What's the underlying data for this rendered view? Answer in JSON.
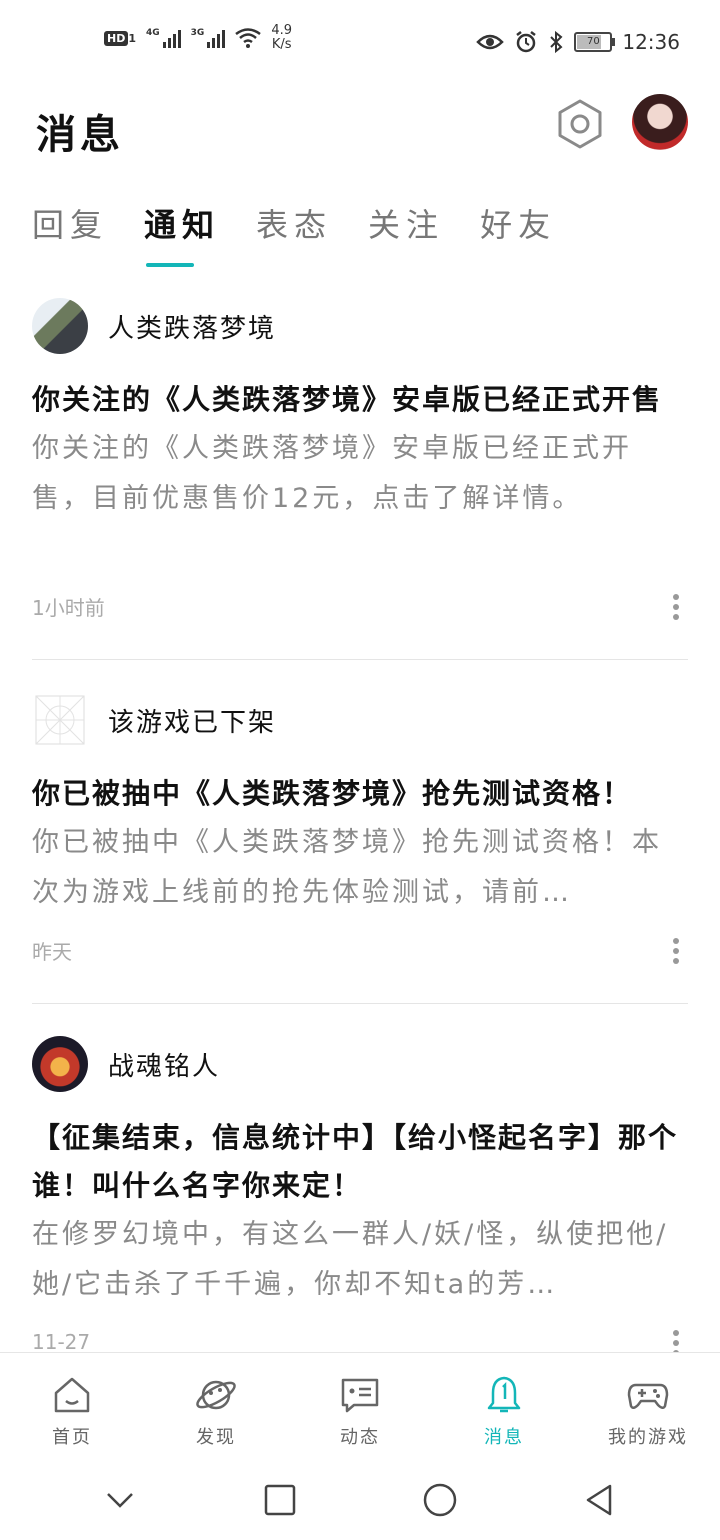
{
  "status_bar": {
    "hd": "HD",
    "sim1": "1",
    "net1": "4G",
    "net2": "3G",
    "speed_value": "4.9",
    "speed_unit": "K/s",
    "battery": "70",
    "time": "12:36"
  },
  "header": {
    "title": "消息"
  },
  "tabs": [
    {
      "label": "回复",
      "active": false
    },
    {
      "label": "通知",
      "active": true
    },
    {
      "label": "表态",
      "active": false
    },
    {
      "label": "关注",
      "active": false
    },
    {
      "label": "好友",
      "active": false
    }
  ],
  "notifications": [
    {
      "source": "人类跌落梦境",
      "title": "你关注的《人类跌落梦境》安卓版已经正式开售",
      "body": "你关注的《人类跌落梦境》安卓版已经正式开售，目前优惠售价12元，点击了解详情。",
      "time": "1小时前"
    },
    {
      "source": "该游戏已下架",
      "title": "你已被抽中《人类跌落梦境》抢先测试资格！",
      "body": "你已被抽中《人类跌落梦境》抢先测试资格！本次为游戏上线前的抢先体验测试，请前…",
      "time": "昨天"
    },
    {
      "source": "战魂铭人",
      "title": "【征集结束，信息统计中】【给小怪起名字】那个谁！叫什么名字你来定！",
      "body": "在修罗幻境中，有这么一群人/妖/怪，纵使把他/她/它击杀了千千遍，你却不知ta的芳…",
      "time": "11-27"
    }
  ],
  "bottom_nav": [
    {
      "label": "首页",
      "icon": "home-icon",
      "active": false
    },
    {
      "label": "发现",
      "icon": "planet-icon",
      "active": false
    },
    {
      "label": "动态",
      "icon": "feed-icon",
      "active": false
    },
    {
      "label": "消息",
      "icon": "bell-icon",
      "active": true
    },
    {
      "label": "我的游戏",
      "icon": "gamepad-icon",
      "active": false
    }
  ],
  "colors": {
    "accent": "#13b6b8",
    "muted_text": "#8a8a8a"
  }
}
